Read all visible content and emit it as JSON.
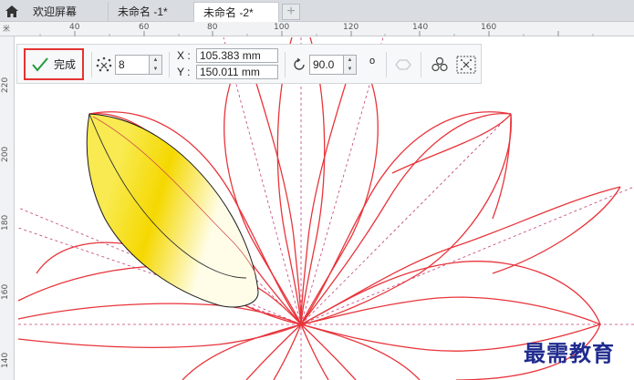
{
  "tabs": [
    {
      "label": "欢迎屏幕"
    },
    {
      "label": "未命名 -1*"
    },
    {
      "label": "未命名 -2*"
    }
  ],
  "tab_add": "+",
  "ruler": {
    "unit": "米",
    "h_labels": [
      "40",
      "60",
      "80",
      "100",
      "120",
      "140",
      "160"
    ],
    "v_labels": [
      "220",
      "200",
      "180",
      "160",
      "140"
    ]
  },
  "propbar": {
    "done_label": "完成",
    "count_value": "8",
    "x_label": "X :",
    "x_value": "105.383 mm",
    "y_label": "Y :",
    "y_value": "150.011 mm",
    "angle_value": "90.0",
    "degree_symbol": "o"
  },
  "colors": {
    "accent_red": "#e53333",
    "petal_stroke": "#e8343a",
    "guide_line": "#c0407a",
    "gradient_yellow": "#f5d800"
  },
  "watermark": "最需教育"
}
